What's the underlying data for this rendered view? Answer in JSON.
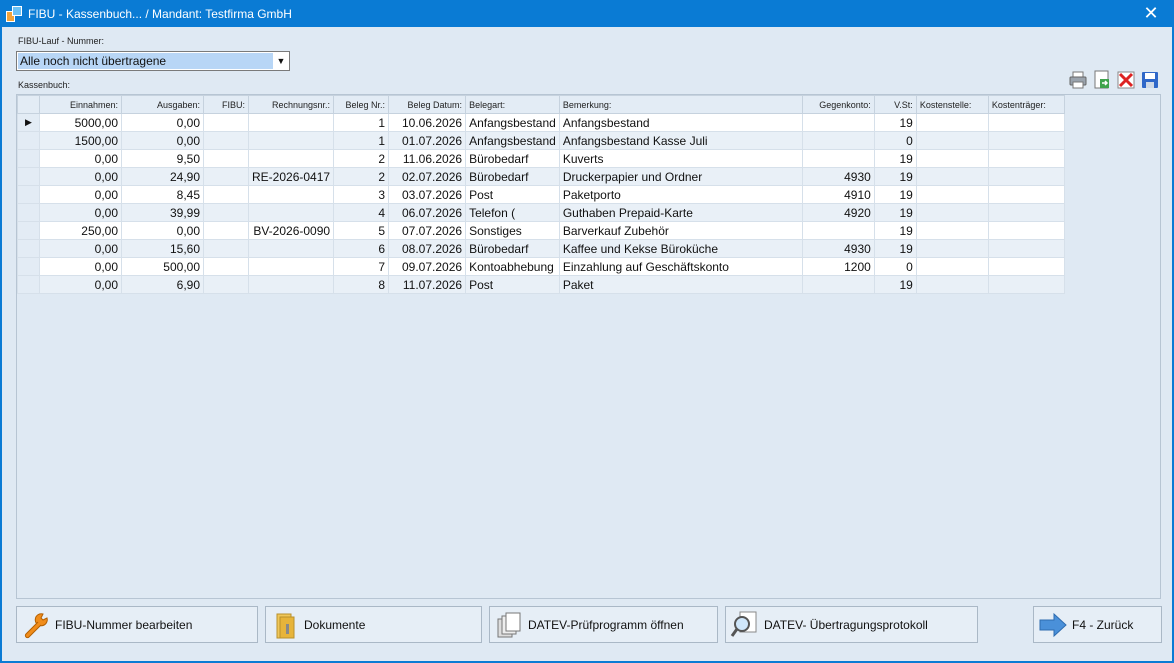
{
  "window": {
    "title": "FIBU - Kassenbuch... / Mandant: Testfirma GmbH",
    "close_glyph": "✕"
  },
  "fibu_lauf": {
    "label": "FIBU-Lauf - Nummer:",
    "selected": "Alle noch nicht übertragene",
    "arrow": "▼"
  },
  "kassenbuch_label": "Kassenbuch:",
  "toolbar": [
    "printer-icon",
    "export-icon",
    "delete-icon",
    "save-icon"
  ],
  "grid": {
    "columns": [
      "Einnahmen:",
      "Ausgaben:",
      "FIBU:",
      "Rechnungsnr.:",
      "Beleg Nr.:",
      "Beleg Datum:",
      "Belegart:",
      "Bemerkung:",
      "Gegenkonto:",
      "V.St:",
      "Kostenstelle:",
      "Kostenträger:"
    ],
    "current_row_marker": "▶",
    "rows": [
      [
        "5000,00",
        "0,00",
        "",
        "",
        "1",
        "10.06.2026",
        "Anfangsbestand",
        "Anfangsbestand",
        "",
        "19",
        "",
        ""
      ],
      [
        "1500,00",
        "0,00",
        "",
        "",
        "1",
        "01.07.2026",
        "Anfangsbestand",
        "Anfangsbestand Kasse Juli",
        "",
        "0",
        "",
        ""
      ],
      [
        "0,00",
        "9,50",
        "",
        "",
        "2",
        "11.06.2026",
        "Bürobedarf",
        "Kuverts",
        "",
        "19",
        "",
        ""
      ],
      [
        "0,00",
        "24,90",
        "",
        "RE-2026-0417",
        "2",
        "02.07.2026",
        "Bürobedarf",
        "Druckerpapier und Ordner",
        "4930",
        "19",
        "",
        ""
      ],
      [
        "0,00",
        "8,45",
        "",
        "",
        "3",
        "03.07.2026",
        "Post",
        "Paketporto",
        "4910",
        "19",
        "",
        ""
      ],
      [
        "0,00",
        "39,99",
        "",
        "",
        "4",
        "06.07.2026",
        "Telefon (",
        "Guthaben Prepaid-Karte",
        "4920",
        "19",
        "",
        ""
      ],
      [
        "250,00",
        "0,00",
        "",
        "BV-2026-0090",
        "5",
        "07.07.2026",
        "Sonstiges",
        "Barverkauf Zubehör",
        "",
        "19",
        "",
        ""
      ],
      [
        "0,00",
        "15,60",
        "",
        "",
        "6",
        "08.07.2026",
        "Bürobedarf",
        "Kaffee und Kekse Büroküche",
        "4930",
        "19",
        "",
        ""
      ],
      [
        "0,00",
        "500,00",
        "",
        "",
        "7",
        "09.07.2026",
        "Kontoabhebung",
        "Einzahlung auf Geschäftskonto",
        "1200",
        "0",
        "",
        ""
      ],
      [
        "0,00",
        "6,90",
        "",
        "",
        "8",
        "11.07.2026",
        "Post",
        "Paket",
        "",
        "19",
        "",
        ""
      ]
    ]
  },
  "buttons": {
    "fibu_edit": "FIBU-Nummer bearbeiten",
    "dokumente": "Dokumente",
    "pruefprogramm": "DATEV-Prüfprogramm öffnen",
    "protokoll": "DATEV- Übertragungsprotokoll",
    "zurueck": "F4 - Zurück"
  }
}
